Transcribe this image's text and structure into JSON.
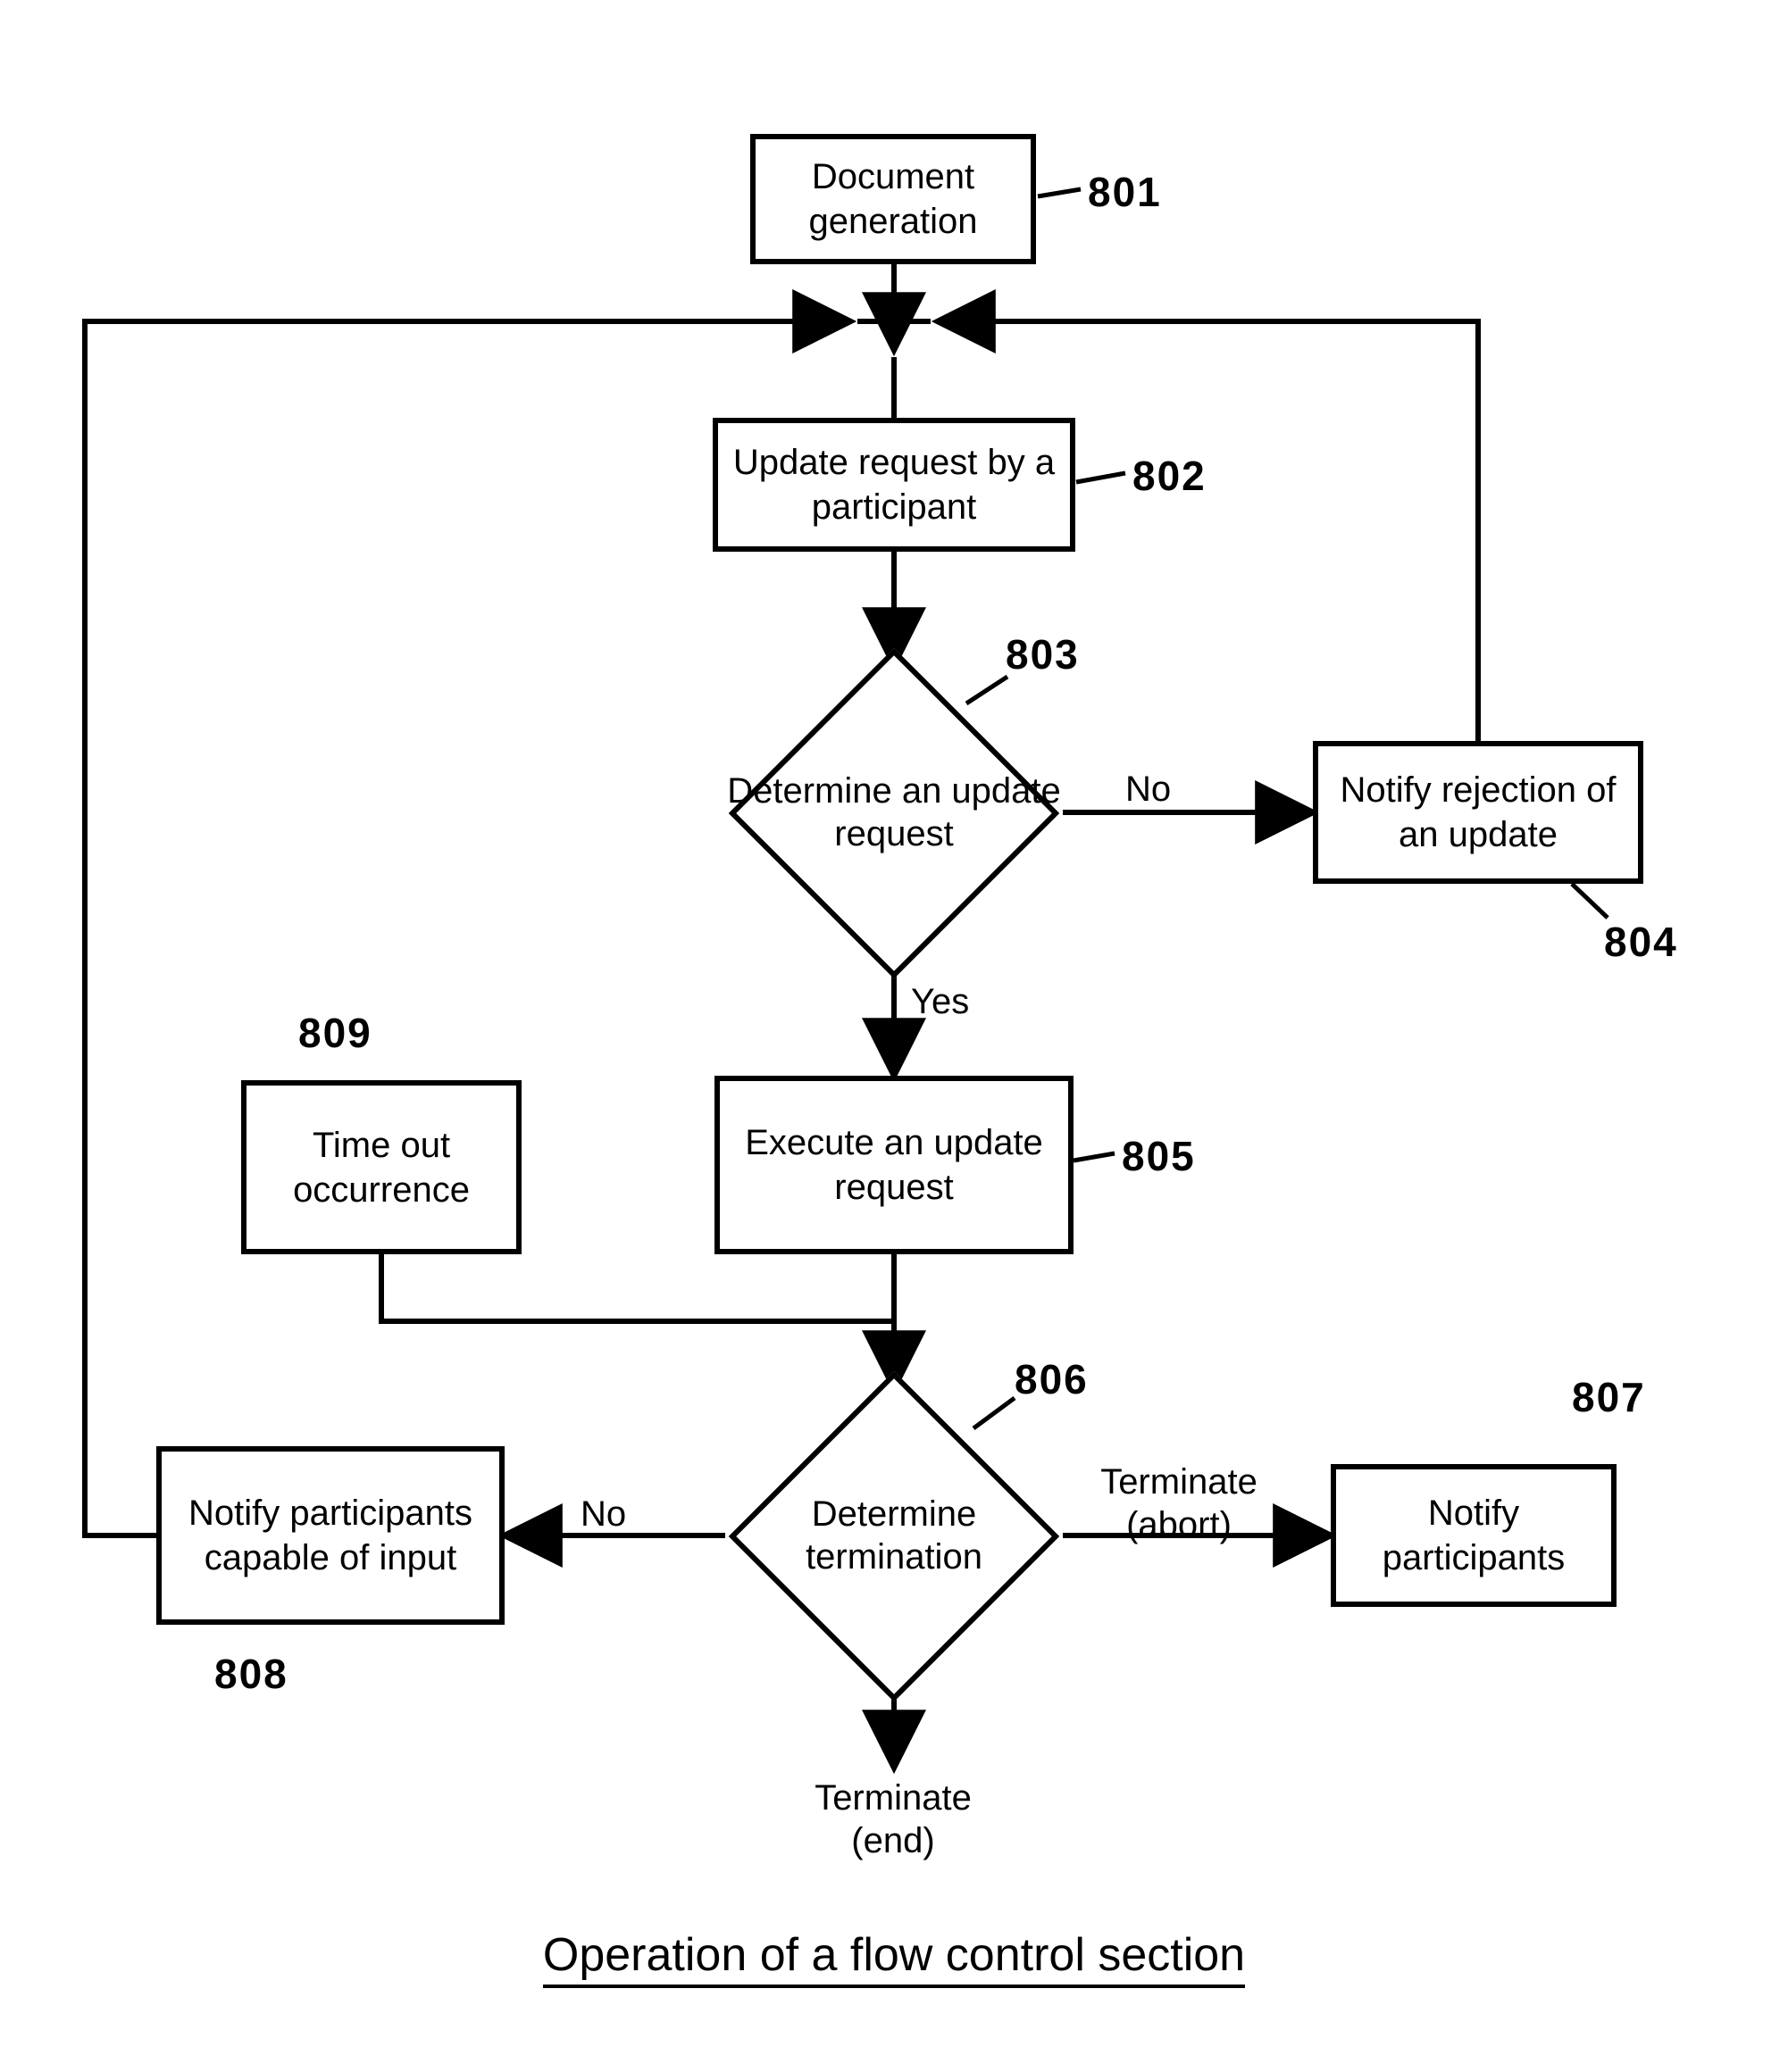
{
  "title": "Operation of a flow control section",
  "nodes": {
    "n801": {
      "num": "801",
      "text": "Document\ngeneration"
    },
    "n802": {
      "num": "802",
      "text": "Update request\nby a participant"
    },
    "n803": {
      "num": "803",
      "text": "Determine\nan update\nrequest"
    },
    "n804": {
      "num": "804",
      "text": "Notify rejection\nof an update"
    },
    "n805": {
      "num": "805",
      "text": "Execute\nan update\nrequest"
    },
    "n806": {
      "num": "806",
      "text": "Determine\ntermination"
    },
    "n807": {
      "num": "807",
      "text": "Notify\nparticipants"
    },
    "n808": {
      "num": "808",
      "text": "Notify\nparticipants\ncapable of input"
    },
    "n809": {
      "num": "809",
      "text": "Time out\noccurrence"
    }
  },
  "edgeLabels": {
    "e803_no": "No",
    "e803_yes": "Yes",
    "e806_no": "No",
    "e806_abort": "Terminate\n(abort)",
    "e806_end": "Terminate\n(end)"
  }
}
